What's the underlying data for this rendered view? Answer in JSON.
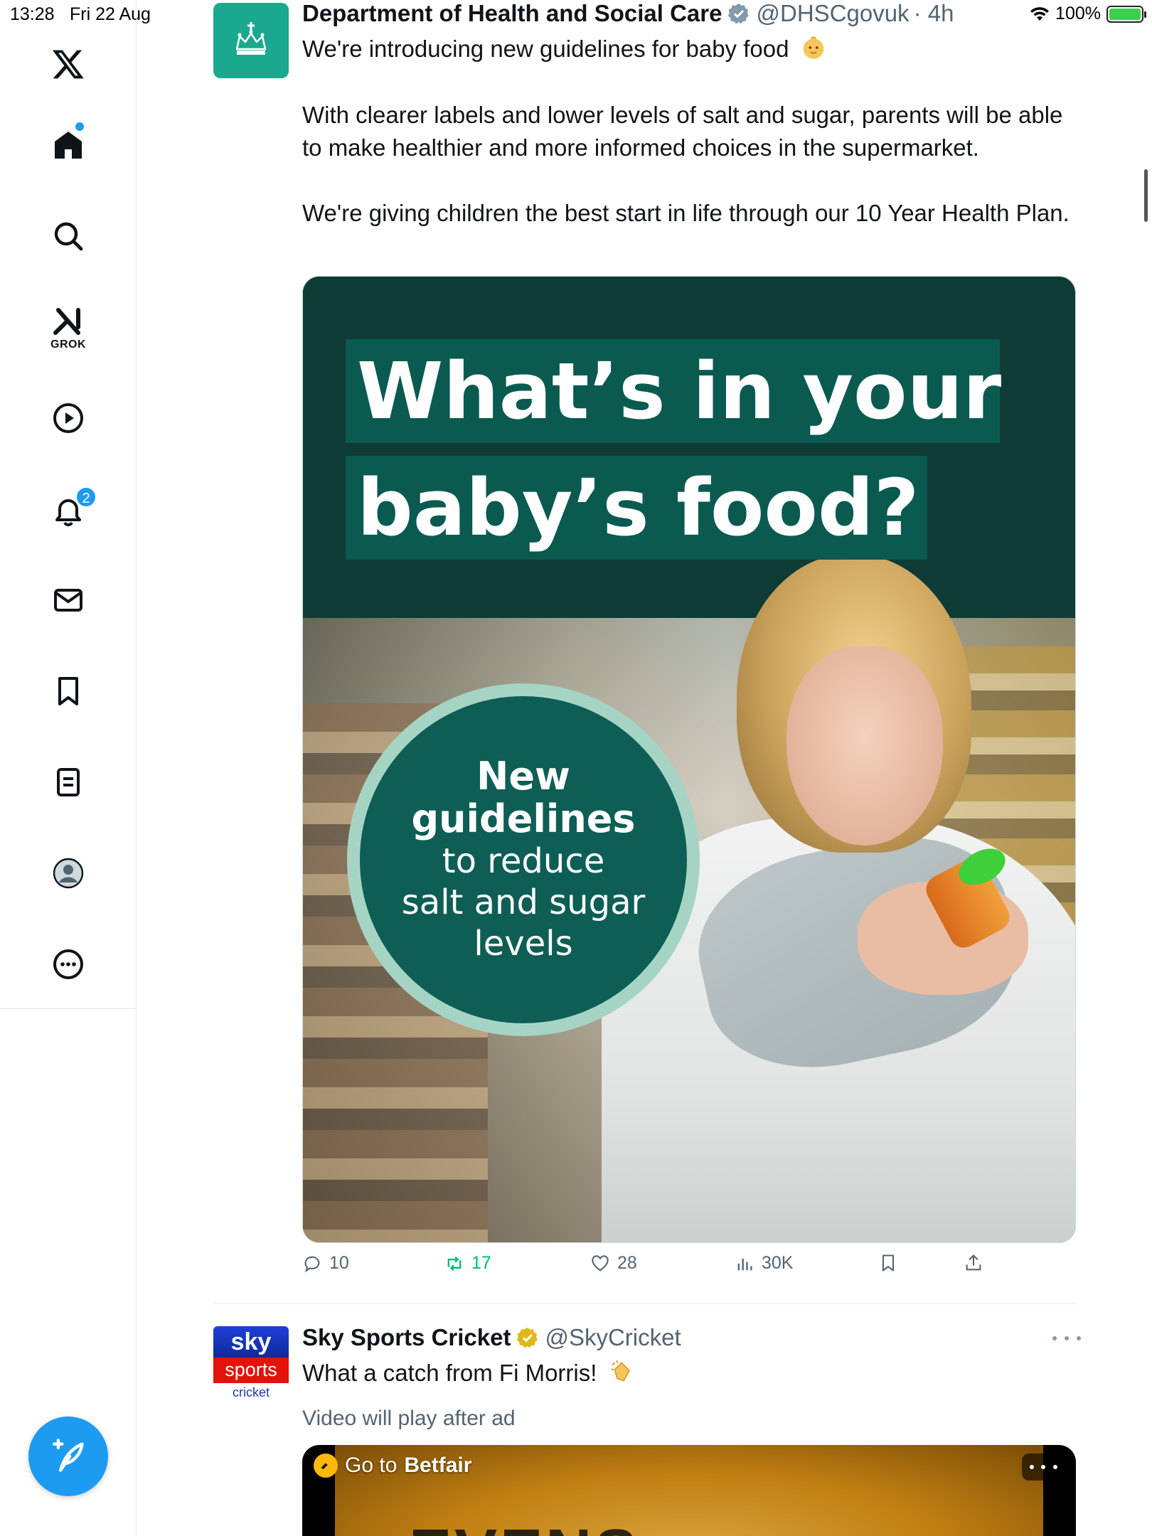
{
  "status_bar": {
    "time": "13:28",
    "date": "Fri 22 Aug",
    "battery": "100%"
  },
  "sidebar": {
    "grok_label": "GROK",
    "notification_count": "2",
    "items": [
      "x-logo",
      "home",
      "search",
      "grok",
      "video",
      "notifications",
      "messages",
      "bookmarks",
      "lists",
      "profile",
      "more"
    ]
  },
  "tweets": [
    {
      "author": "Department of Health and Social Care",
      "handle": "@DHSCgovuk",
      "time": "· 4h",
      "text_line1": "We're introducing new guidelines for baby food",
      "text_para2": "With clearer labels and lower levels of salt and sugar, parents will be able to make healthier and more informed choices in the supermarket.",
      "text_para3": "We're giving children the best start in life through our 10 Year Health Plan.",
      "media": {
        "headline_line1": "What’s in your",
        "headline_line2": "baby’s food?",
        "badge_line1": "New",
        "badge_line2": "guidelines",
        "badge_line3": "to reduce",
        "badge_line4": "salt and sugar",
        "badge_line5": "levels"
      },
      "stats": {
        "replies": "10",
        "retweets": "17",
        "likes": "28",
        "views": "30K"
      }
    },
    {
      "author": "Sky Sports Cricket",
      "handle": "@SkyCricket",
      "text": "What a catch from Fi Morris!",
      "avatar": {
        "top": "sky",
        "mid": "sports",
        "bot": "cricket"
      },
      "ad_note": "Video will play after ad",
      "video": {
        "go_to": "Go to",
        "brand": "Betfair",
        "overlay_text": "EVENS"
      }
    }
  ],
  "colors": {
    "accent": "#1d9bf0",
    "retweet_active": "#00ba7c",
    "dhsc_green": "#1aa98f",
    "banner_green": "#0a5a50"
  }
}
